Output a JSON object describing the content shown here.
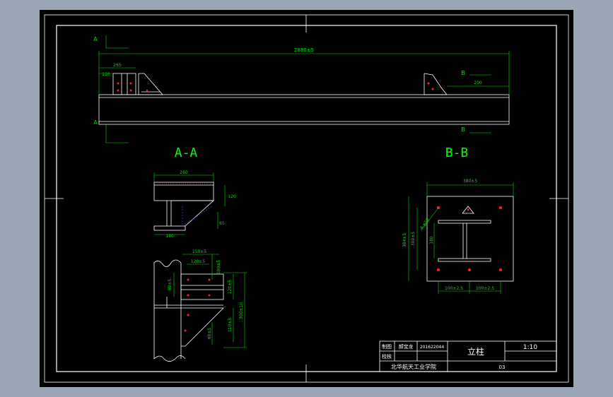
{
  "colors": {
    "background": "#9aa6b8",
    "sheet": "#000000",
    "line": "#ffffff",
    "dimension": "#00e000",
    "section_label": "#00ff00",
    "hole_mark": "#ff2020",
    "hidden_line": "#4040ff"
  },
  "section_marks": {
    "a_top": "A",
    "a_bottom": "A",
    "b_top": "B",
    "b_bottom": "B"
  },
  "top_view": {
    "overall_length": "2880±5",
    "dim_left_width": "265",
    "dim_left_height": "120",
    "dim_right": "200"
  },
  "section_aa": {
    "title": "A-A",
    "dim_top_width": "260",
    "dim_right_height": "120",
    "dim_right_lower": "65",
    "dim_bottom_width": "180"
  },
  "section_bb": {
    "title": "B-B",
    "dim_top_width": "380±5",
    "dim_left_outer": "384±5",
    "dim_left_inner": "300±5",
    "dim_diag": "4-φ26",
    "dim_web": "180",
    "dim_bottom_left": "100±2.5",
    "dim_bottom_right": "100±2.5"
  },
  "detail_view": {
    "dim_top_1": "150±5",
    "dim_top_2": "120±5",
    "dim_top_3": "100±5",
    "dim_left_1": "80±5",
    "dim_right_1": "120±5",
    "dim_right_2": "300±10",
    "dim_right_3": "110±5",
    "dim_bottom_1": "60±5"
  },
  "title_block": {
    "row1_role": "制图",
    "row1_name": "郝宝龙",
    "row1_id": "201622044",
    "row2_role": "校核",
    "part_name": "立柱",
    "scale": "1:10",
    "school": "北华航天工业学院",
    "drawing_no": "03"
  }
}
